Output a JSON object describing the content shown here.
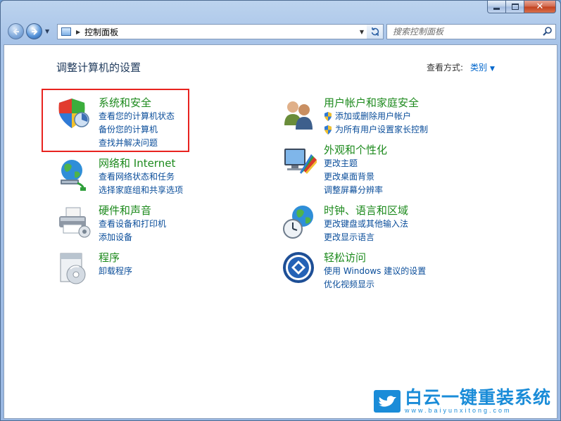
{
  "window": {
    "caption": {
      "close_glyph": "✕"
    }
  },
  "navbar": {
    "breadcrumb_arrow": "▶",
    "dropdown_arrow": "▼",
    "history_arrow": "▼",
    "address_text": "控制面板",
    "search_placeholder": "搜索控制面板"
  },
  "content": {
    "page_title": "调整计算机的设置",
    "view_by_label": "查看方式:",
    "view_by_value": "类别",
    "view_by_arrow": "▼",
    "categories": [
      {
        "title": "系统和安全",
        "icon": "shield-icon",
        "links": [
          "查看您的计算机状态",
          "备份您的计算机",
          "查找并解决问题"
        ]
      },
      {
        "title": "网络和 Internet",
        "icon": "network-globe-icon",
        "links": [
          "查看网络状态和任务",
          "选择家庭组和共享选项"
        ]
      },
      {
        "title": "硬件和声音",
        "icon": "printer-icon",
        "links": [
          "查看设备和打印机",
          "添加设备"
        ]
      },
      {
        "title": "程序",
        "icon": "programs-icon",
        "links": [
          "卸载程序"
        ]
      },
      {
        "title": "用户帐户和家庭安全",
        "icon": "users-icon",
        "links": [
          "添加或删除用户帐户",
          "为所有用户设置家长控制"
        ]
      },
      {
        "title": "外观和个性化",
        "icon": "monitor-palette-icon",
        "links": [
          "更改主题",
          "更改桌面背景",
          "调整屏幕分辨率"
        ]
      },
      {
        "title": "时钟、语言和区域",
        "icon": "clock-globe-icon",
        "links": [
          "更改键盘或其他输入法",
          "更改显示语言"
        ]
      },
      {
        "title": "轻松访问",
        "icon": "ease-of-access-icon",
        "links": [
          "使用 Windows 建议的设置",
          "优化视频显示"
        ]
      }
    ]
  },
  "watermark": {
    "text": "白云一键重装系统",
    "url": "www.baiyunxitong.com"
  },
  "colors": {
    "category_title": "#1d8a1d",
    "link": "#0a4d9a",
    "highlight": "#e8231f",
    "watermark": "#1a8cd8"
  }
}
